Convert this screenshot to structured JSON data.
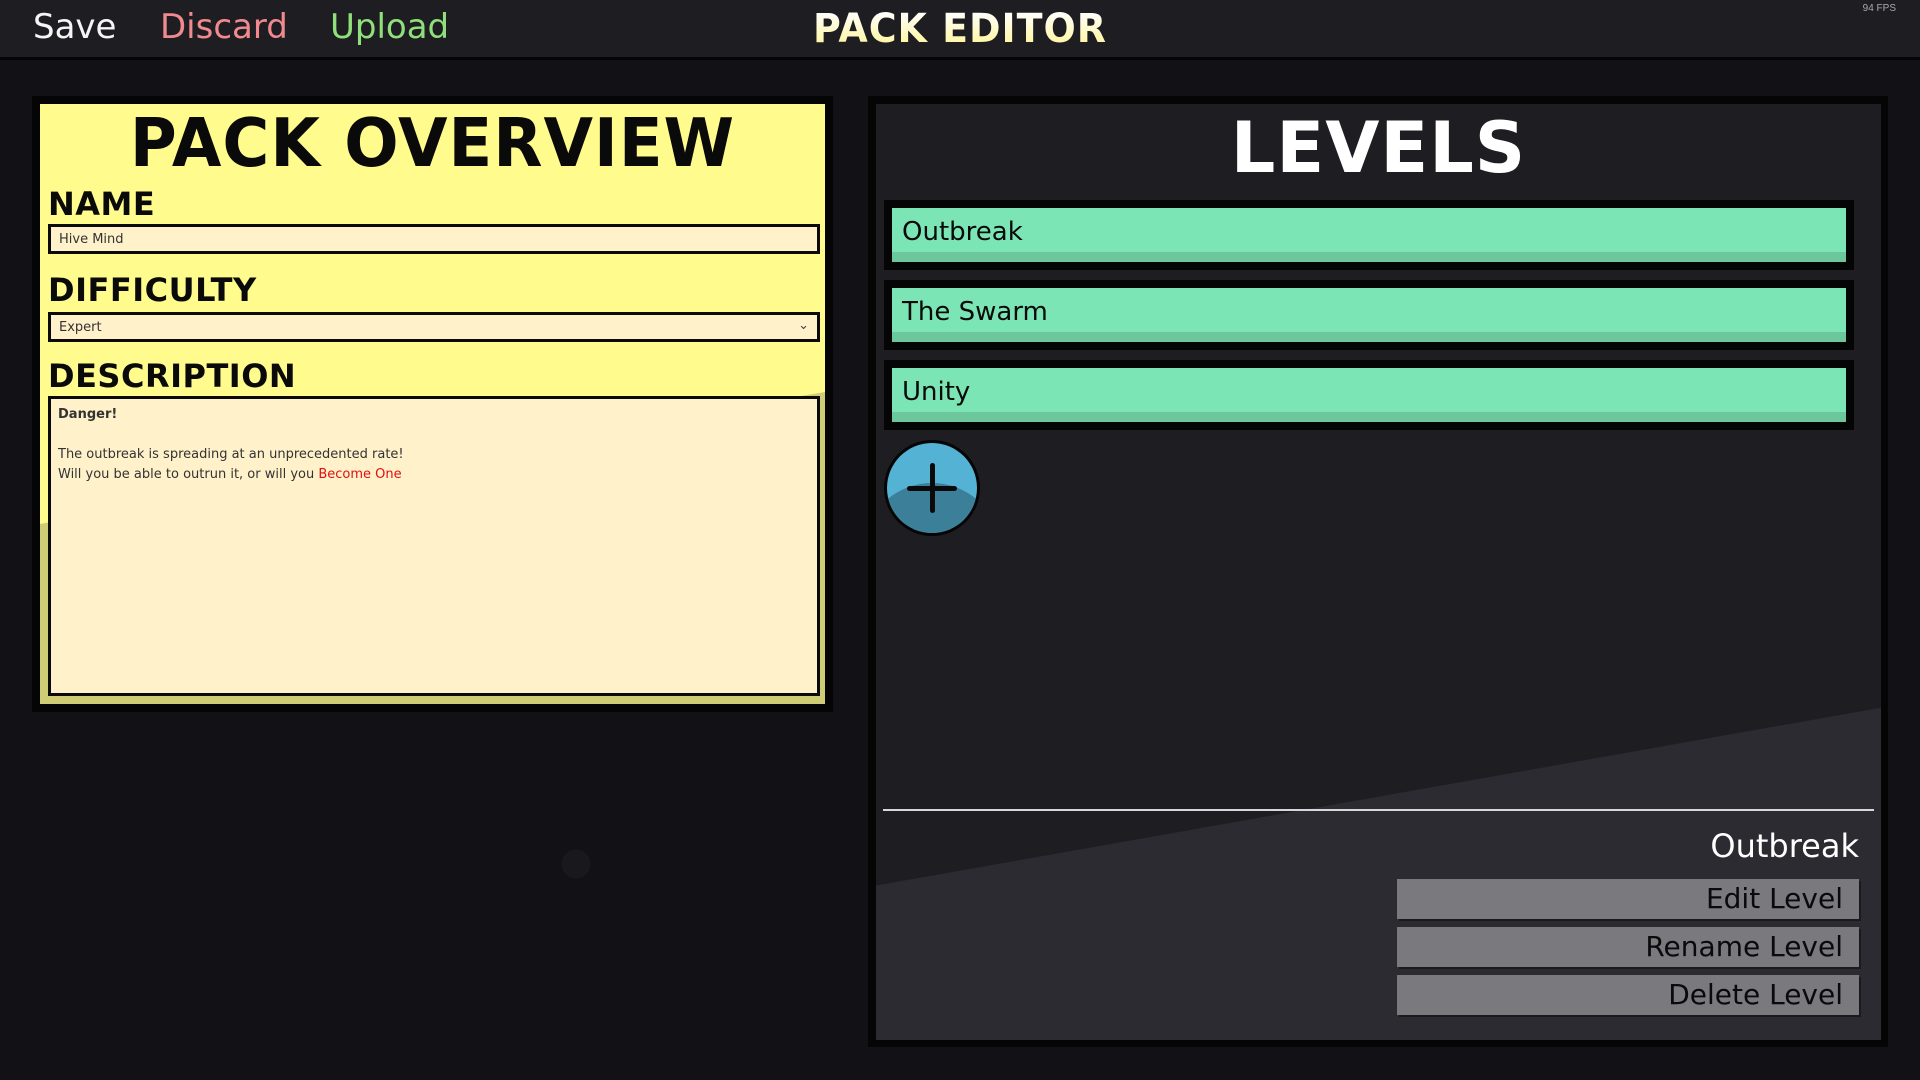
{
  "topbar": {
    "save_label": "Save",
    "discard_label": "Discard",
    "upload_label": "Upload",
    "title": "PACK EDITOR",
    "fps": "94 FPS"
  },
  "overview": {
    "title": "PACK OVERVIEW",
    "name_label": "NAME",
    "name_value": "Hive Mind",
    "difficulty_label": "DIFFICULTY",
    "difficulty_value": "Expert",
    "difficulty_chevron": "⌄",
    "description_label": "DESCRIPTION",
    "description": {
      "line1": "Danger!",
      "line2": "The outbreak is spreading at an unprecedented rate!",
      "line3_prefix": "Will you be able to outrun it, or will you ",
      "line3_highlight": "Become One"
    }
  },
  "levels": {
    "title": "LEVELS",
    "items": [
      {
        "label": "Outbreak"
      },
      {
        "label": "The Swarm"
      },
      {
        "label": "Unity"
      }
    ],
    "add_icon": "plus-icon",
    "selected": "Outbreak",
    "edit_label": "Edit Level",
    "rename_label": "Rename Level",
    "delete_label": "Delete Level"
  },
  "colors": {
    "save": "#f5f5f5",
    "discard": "#f08a8f",
    "upload": "#8fe07a",
    "overview_bg": "#fffb8c",
    "level_item": "#7be5b6",
    "add_button": "#54b2d4",
    "highlight_text": "#e01010"
  }
}
